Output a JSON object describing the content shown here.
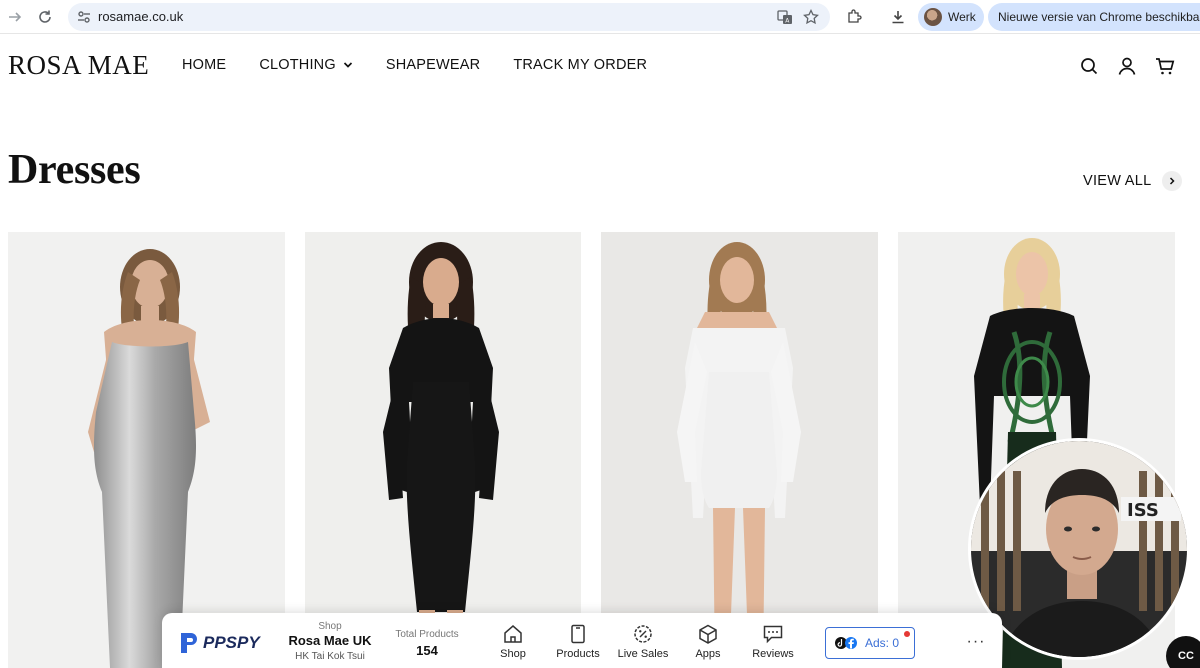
{
  "browser": {
    "url": "rosamae.co.uk",
    "profile_label": "Werk",
    "update_label": "Nieuwe versie van Chrome beschikbaar",
    "icons": [
      "forward-icon",
      "reload-icon",
      "site-settings-icon",
      "translate-icon",
      "bookmark-star-icon",
      "extensions-icon",
      "download-icon"
    ]
  },
  "site": {
    "logo": "ROSA MAE",
    "nav": {
      "home": "HOME",
      "clothing": "CLOTHING",
      "shapewear": "SHAPEWEAR",
      "track": "TRACK MY ORDER"
    },
    "header_icons": [
      "search-icon",
      "account-icon",
      "cart-icon"
    ]
  },
  "section": {
    "title": "Dresses",
    "view_all": "VIEW ALL"
  },
  "products": [
    {
      "dress": "silver metallic maxi",
      "color": "#b8b8b8"
    },
    {
      "dress": "black long-sleeve midi",
      "color": "#141414"
    },
    {
      "dress": "white off-shoulder mini",
      "color": "#f2f2f2"
    },
    {
      "dress": "black and green long-sleeve",
      "color": "#1f3b24"
    }
  ],
  "ppspy": {
    "brand": "PPSPY",
    "shop_label": "Shop",
    "shop_name": "Rosa Mae UK",
    "shop_location": "HK Tai Kok Tsui",
    "total_label": "Total Products",
    "total_value": "154",
    "tabs": {
      "shop": "Shop",
      "products": "Products",
      "live_sales": "Live Sales",
      "apps": "Apps",
      "reviews": "Reviews"
    },
    "ads_label": "Ads: 0",
    "more": "···"
  },
  "cc_label": "CC"
}
